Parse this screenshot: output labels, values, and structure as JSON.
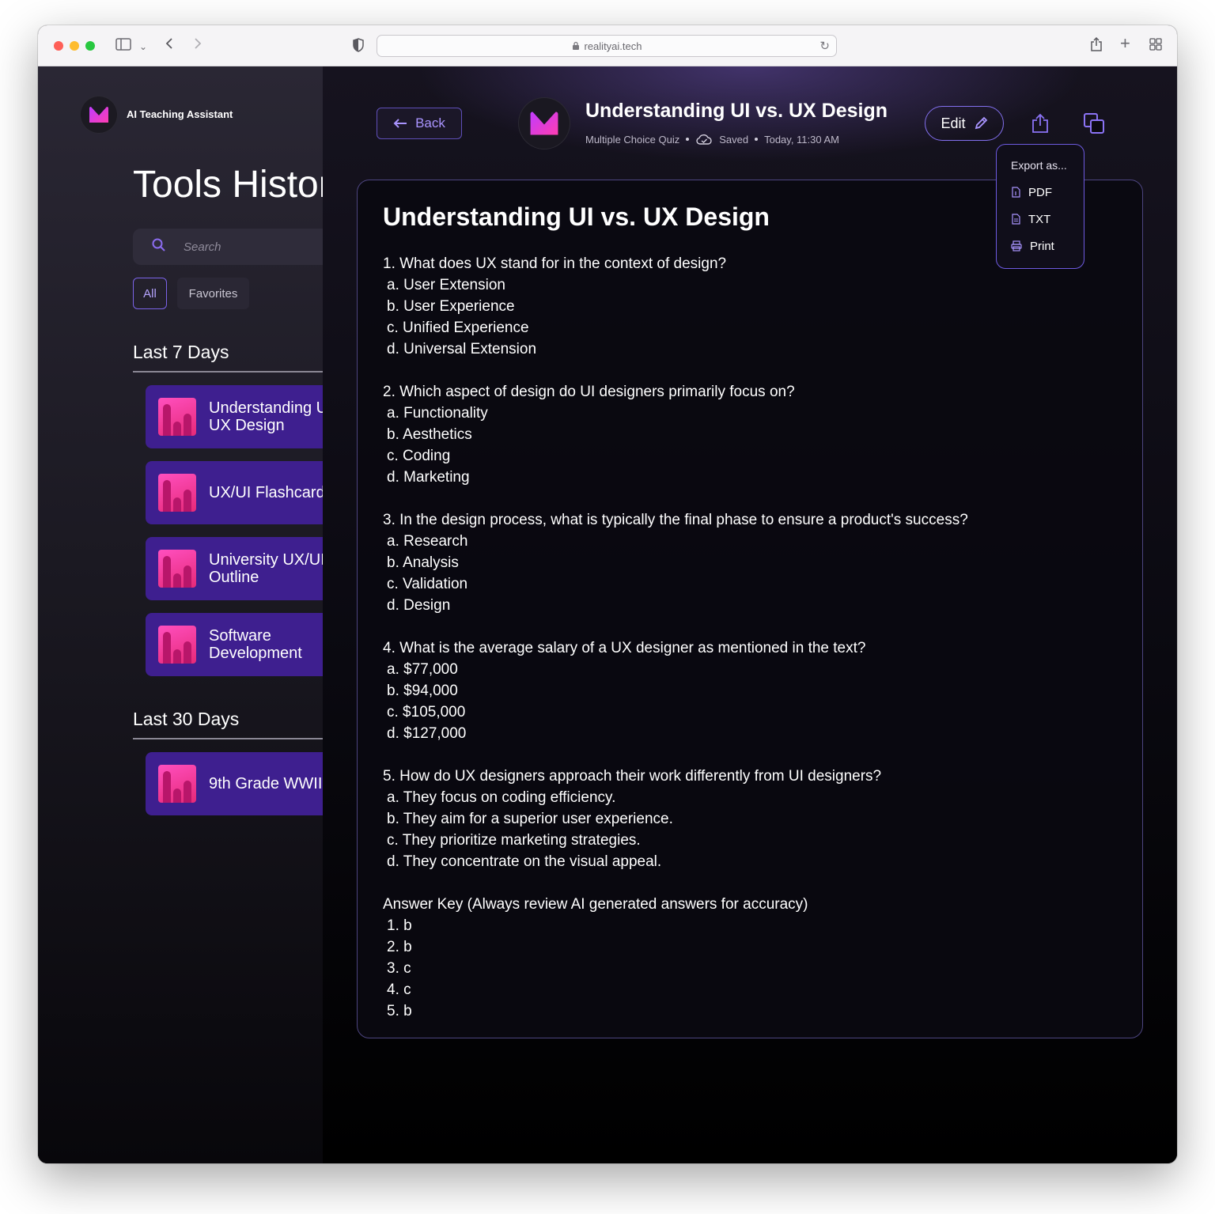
{
  "browser": {
    "url": "realityai.tech"
  },
  "sidebar": {
    "brand_name": "AI Teaching Assistant",
    "title": "Tools History",
    "search_placeholder": "Search",
    "filters": {
      "all": "All",
      "favorites": "Favorites"
    },
    "sections": [
      {
        "label": "Last 7 Days",
        "items": [
          {
            "label": "Understanding UI vs. UX Design"
          },
          {
            "label": "UX/UI Flashcards"
          },
          {
            "label": "University UX/UI\nOutline"
          },
          {
            "label": "Software Development"
          }
        ]
      },
      {
        "label": "Last 30 Days",
        "items": [
          {
            "label": "9th Grade WWII"
          }
        ]
      }
    ]
  },
  "header": {
    "back_label": "Back",
    "title": "Understanding UI vs. UX Design",
    "type": "Multiple Choice Quiz",
    "status": "Saved",
    "timestamp": "Today, 11:30 AM",
    "edit_label": "Edit"
  },
  "export_menu": {
    "title": "Export as...",
    "items": [
      "PDF",
      "TXT",
      "Print"
    ]
  },
  "document": {
    "title": "Understanding UI vs. UX Design",
    "questions": [
      {
        "q": "1. What does UX stand for in the context of design?",
        "options": [
          "a. User Extension",
          "b. User Experience",
          "c. Unified Experience",
          "d. Universal Extension"
        ]
      },
      {
        "q": "2. Which aspect of design do UI designers primarily focus on?",
        "options": [
          "a. Functionality",
          "b. Aesthetics",
          "c. Coding",
          "d. Marketing"
        ]
      },
      {
        "q": "3. In the design process, what is typically the final phase to ensure a product's success?",
        "options": [
          "a. Research",
          "b. Analysis",
          "c. Validation",
          "d. Design"
        ]
      },
      {
        "q": "4. What is the average salary of a UX designer as mentioned in the text?",
        "options": [
          "a.  $77,000",
          "b.  $94,000",
          "c.  $105,000",
          "d.  $127,000"
        ]
      },
      {
        "q": "5. How do UX designers approach their work differently from UI designers?",
        "options": [
          "a. They focus on coding efficiency.",
          "b. They aim for a superior user experience.",
          "c. They prioritize marketing strategies.",
          "d. They concentrate on the visual appeal."
        ]
      }
    ],
    "answer_key_title": "Answer Key (Always review AI generated answers for accuracy)",
    "answers": [
      "1. b",
      "2. b",
      "3. c",
      "4. c",
      "5. b"
    ]
  },
  "colors": {
    "accent": "#8370ef",
    "history_item_bg": "#3e1f8f",
    "thumb_pink": "#ff4fbf"
  }
}
